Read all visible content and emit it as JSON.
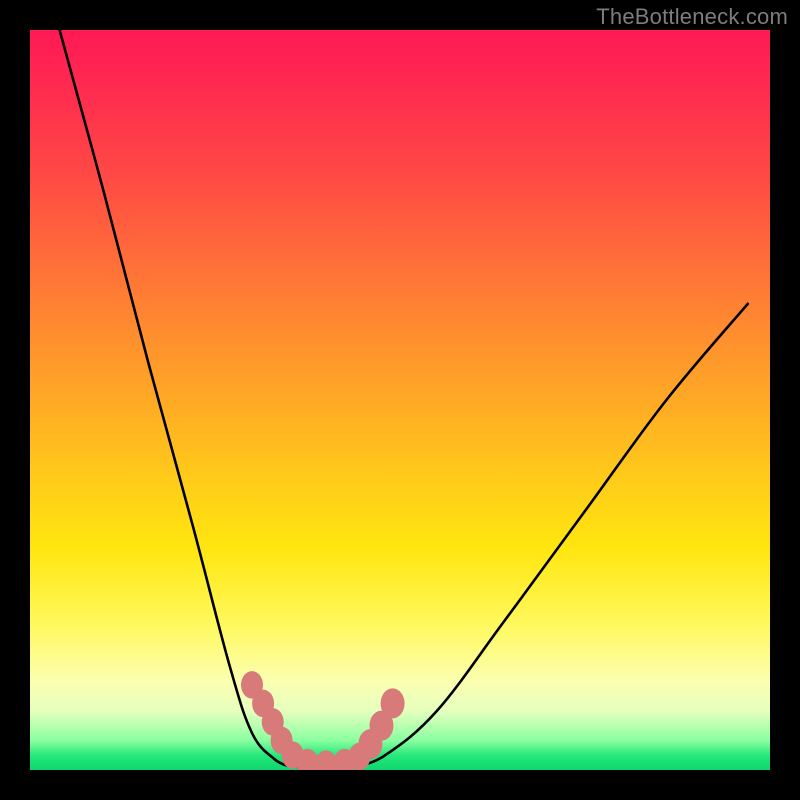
{
  "watermark": "TheBottleneck.com",
  "chart_data": {
    "type": "line",
    "title": "",
    "xlabel": "",
    "ylabel": "",
    "xlim": [
      0,
      1
    ],
    "ylim": [
      0,
      1
    ],
    "background_gradient": {
      "top": "#ff1955",
      "mid_upper": "#ff7a35",
      "mid": "#ffe60f",
      "lower": "#fbffb0",
      "bottom": "#0ed66e"
    },
    "series": [
      {
        "name": "left-curve",
        "stroke": "#000000",
        "x": [
          0.04,
          0.1,
          0.16,
          0.22,
          0.27,
          0.3,
          0.33,
          0.35
        ],
        "y": [
          1.0,
          0.78,
          0.55,
          0.33,
          0.14,
          0.05,
          0.015,
          0.005
        ]
      },
      {
        "name": "valley-floor",
        "stroke": "#000000",
        "x": [
          0.35,
          0.38,
          0.41,
          0.44
        ],
        "y": [
          0.005,
          0.003,
          0.003,
          0.005
        ]
      },
      {
        "name": "right-curve",
        "stroke": "#000000",
        "x": [
          0.44,
          0.48,
          0.55,
          0.64,
          0.75,
          0.86,
          0.97
        ],
        "y": [
          0.005,
          0.02,
          0.08,
          0.2,
          0.35,
          0.5,
          0.63
        ]
      }
    ],
    "markers": {
      "name": "bead-markers",
      "color": "#d97a7a",
      "x": [
        0.3,
        0.315,
        0.328,
        0.34,
        0.355,
        0.375,
        0.4,
        0.425,
        0.445,
        0.46,
        0.475,
        0.49
      ],
      "y": [
        0.115,
        0.09,
        0.065,
        0.04,
        0.02,
        0.01,
        0.008,
        0.01,
        0.018,
        0.035,
        0.06,
        0.09
      ],
      "r": [
        11,
        11,
        11,
        11,
        11,
        11,
        11,
        11,
        11,
        12,
        12,
        12
      ]
    }
  }
}
